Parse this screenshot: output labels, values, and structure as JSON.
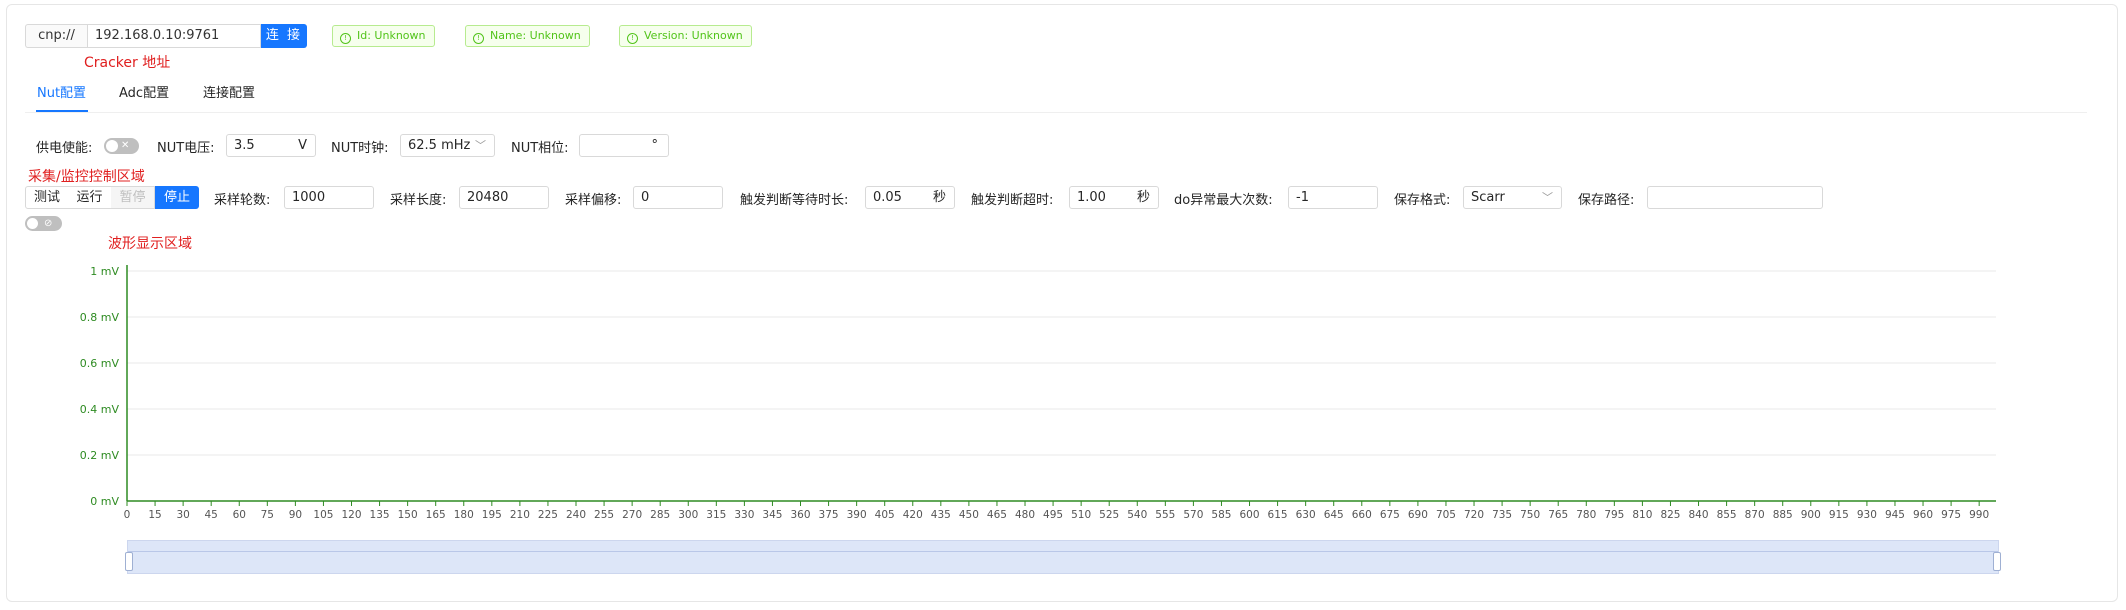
{
  "connection": {
    "scheme": "cnp://",
    "address": "192.168.0.10:9761",
    "connect_label": "连 接",
    "note": "Cracker 地址"
  },
  "status_tags": [
    {
      "label": "Id: Unknown"
    },
    {
      "label": "Name: Unknown"
    },
    {
      "label": "Version: Unknown"
    }
  ],
  "tabs": [
    {
      "label": "Nut配置",
      "active": true
    },
    {
      "label": "Adc配置",
      "active": false
    },
    {
      "label": "连接配置",
      "active": false
    }
  ],
  "nut": {
    "power_label": "供电使能:",
    "power_on": false,
    "voltage_label": "NUT电压:",
    "voltage_value": "3.5",
    "voltage_unit": "V",
    "clock_label": "NUT时钟:",
    "clock_value": "62.5 mHz",
    "phase_label": "NUT相位:",
    "phase_value": "",
    "phase_unit": "°"
  },
  "acq": {
    "note": "采集/监控控制区域",
    "buttons": {
      "test": "测试",
      "run": "运行",
      "pause": "暂停",
      "stop": "停止"
    },
    "rounds_label": "采样轮数:",
    "rounds_value": "1000",
    "length_label": "采样长度:",
    "length_value": "20480",
    "offset_label": "采样偏移:",
    "offset_value": "0",
    "trigger_wait_label": "触发判断等待时长:",
    "trigger_wait_value": "0.05",
    "trigger_wait_unit": "秒",
    "trigger_timeout_label": "触发判断超时:",
    "trigger_timeout_value": "1.00",
    "trigger_timeout_unit": "秒",
    "do_max_label": "do异常最大次数:",
    "do_max_value": "-1",
    "format_label": "保存格式:",
    "format_value": "Scarr",
    "path_label": "保存路径:",
    "path_value": "",
    "monitor_on": false
  },
  "waveform": {
    "note": "波形显示区域"
  },
  "colors": {
    "accent": "#1677ff",
    "axis_green": "#2e8b22",
    "tag_green": "#52c41a",
    "note_red": "#e02020"
  },
  "chart_data": {
    "type": "line",
    "title": "",
    "xlabel": "",
    "ylabel": "",
    "x_ticks": [
      0,
      15,
      30,
      45,
      60,
      75,
      90,
      105,
      120,
      135,
      150,
      165,
      180,
      195,
      210,
      225,
      240,
      255,
      270,
      285,
      300,
      315,
      330,
      345,
      360,
      375,
      390,
      405,
      420,
      435,
      450,
      465,
      480,
      495,
      510,
      525,
      540,
      555,
      570,
      585,
      600,
      615,
      630,
      645,
      660,
      675,
      690,
      705,
      720,
      735,
      750,
      765,
      780,
      795,
      810,
      825,
      840,
      855,
      870,
      885,
      900,
      915,
      930,
      945,
      960,
      975,
      990
    ],
    "y_ticks": [
      "0 mV",
      "0.2 mV",
      "0.4 mV",
      "0.6 mV",
      "0.8 mV",
      "1 mV"
    ],
    "ylim": [
      0,
      1
    ],
    "xlim": [
      0,
      999
    ],
    "series": [],
    "grid": true,
    "zoom_range": [
      0,
      100
    ]
  }
}
